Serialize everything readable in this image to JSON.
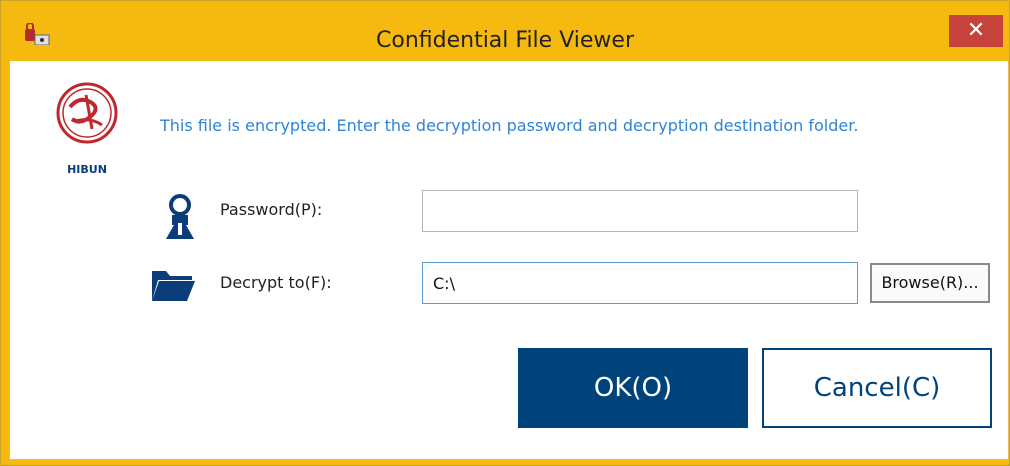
{
  "window": {
    "title": "Confidential File Viewer",
    "close_glyph": "✕"
  },
  "logo": {
    "brand": "HIBUN",
    "icon": "hibun-seal-logo"
  },
  "message": "This file is encrypted. Enter the decryption password and decryption destination folder.",
  "password": {
    "label": "Password(P):",
    "value": "",
    "icon": "key-user-icon"
  },
  "decrypt_to": {
    "label": "Decrypt to(F):",
    "value": "C:\\",
    "icon": "folder-icon"
  },
  "buttons": {
    "browse": "Browse(R)...",
    "ok": "OK(O)",
    "cancel": "Cancel(C)"
  },
  "colors": {
    "titlebar": "#f5b90f",
    "close": "#c7423a",
    "primary": "#00427a",
    "message": "#2f84d7"
  }
}
